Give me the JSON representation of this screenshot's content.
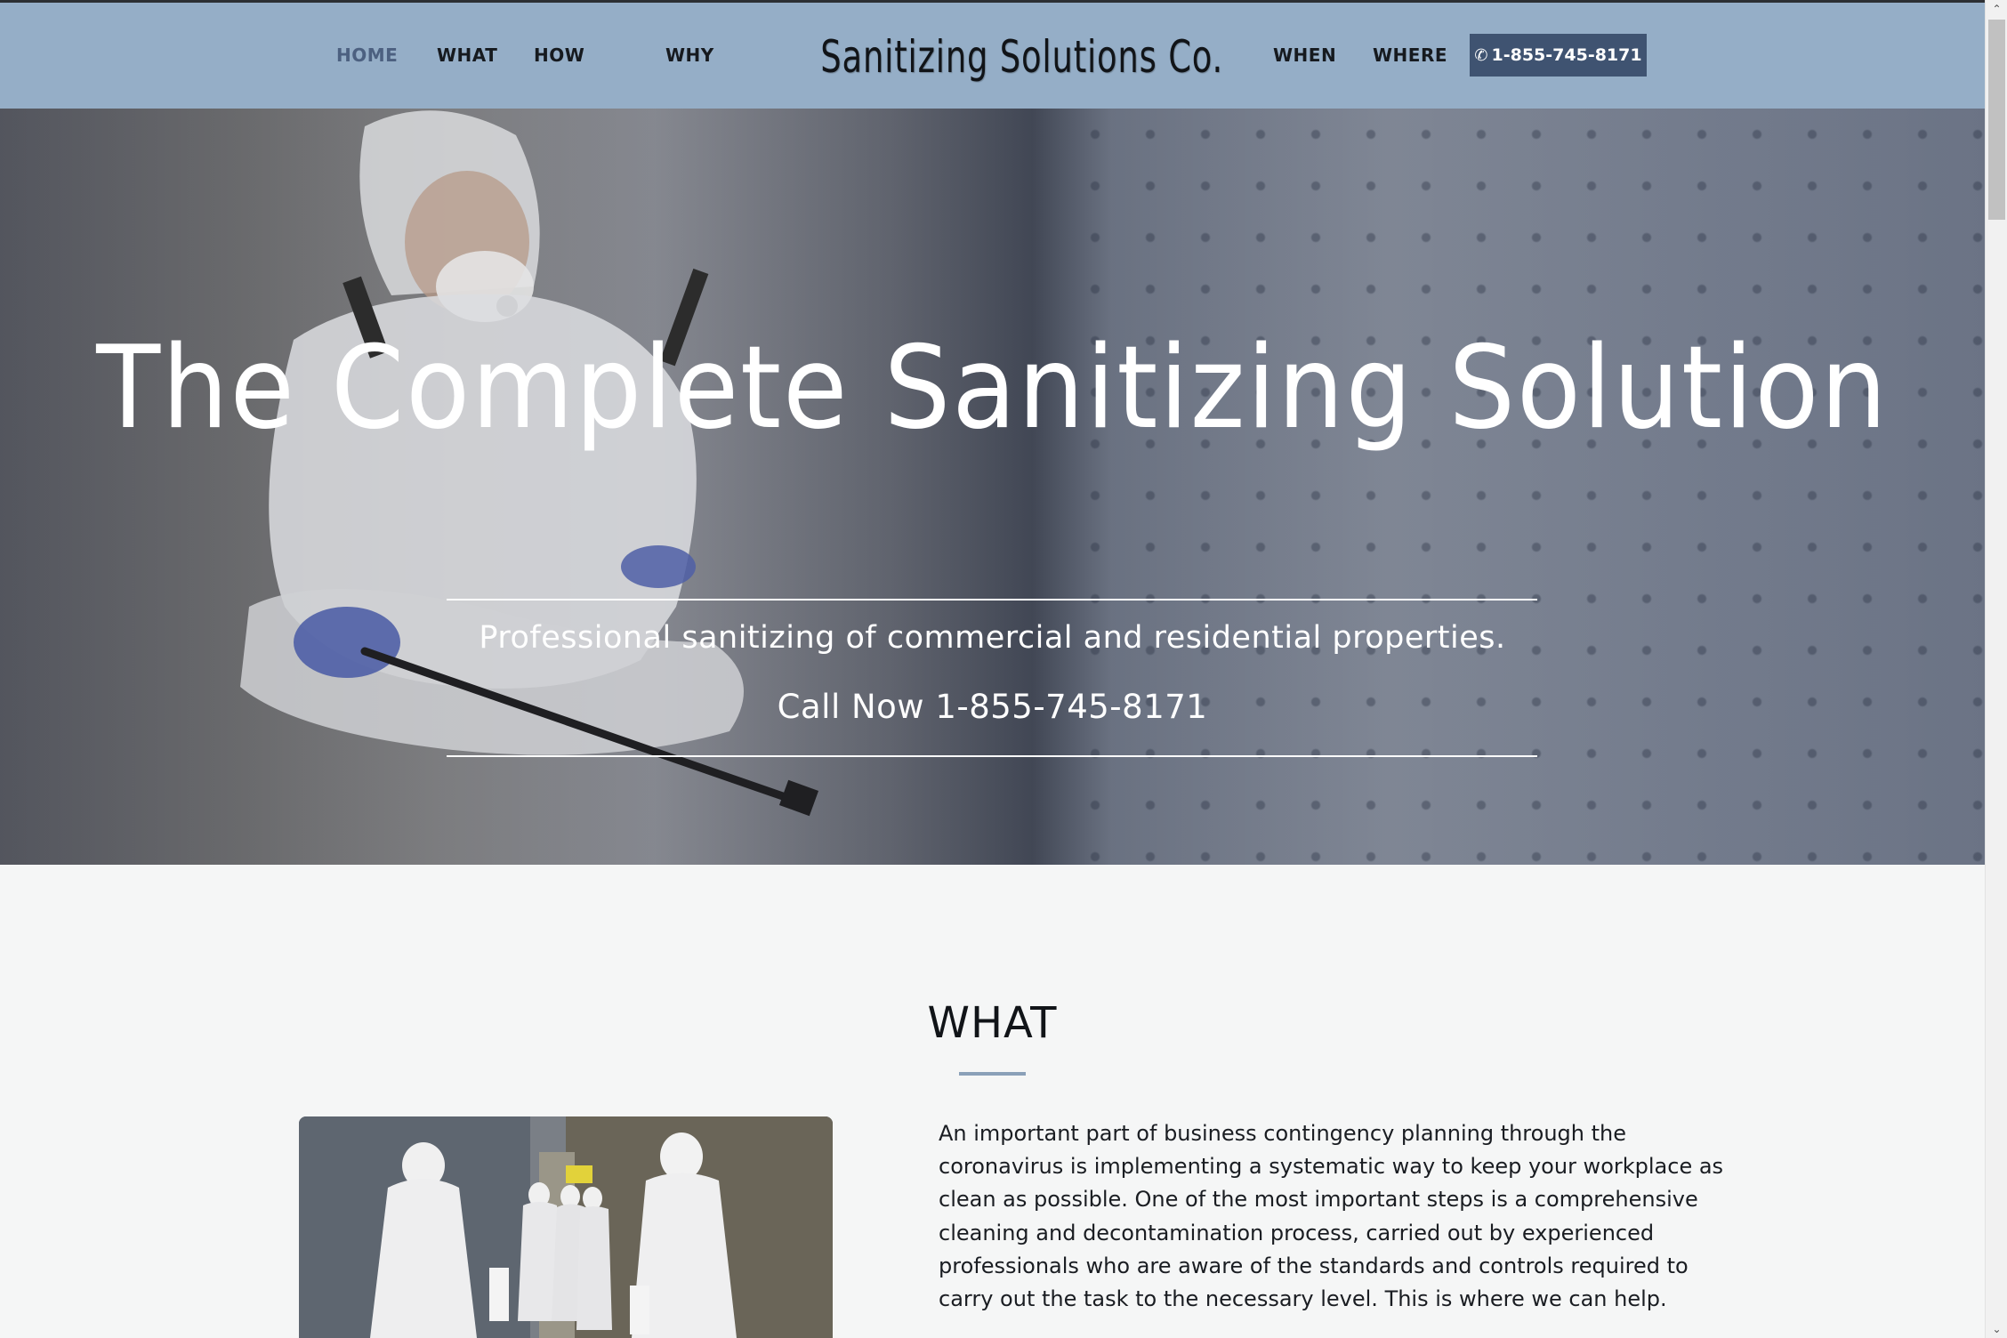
{
  "nav": {
    "left_items": [
      {
        "label": "HOME",
        "active": true
      },
      {
        "label": "WHAT"
      },
      {
        "label": "HOW"
      },
      {
        "label": "WHY"
      }
    ],
    "right_items": [
      {
        "label": "WHEN"
      },
      {
        "label": "WHERE"
      }
    ],
    "brand": "Sanitizing Solutions Co.",
    "phone_button": {
      "label": "1-855-745-8171",
      "icon": "phone-icon"
    }
  },
  "hero": {
    "title": "The Complete Sanitizing Solution",
    "subtitle": "Professional sanitizing of commercial and residential properties.",
    "call": "Call Now 1-855-745-8171"
  },
  "what_section": {
    "heading": "WHAT",
    "body": "An important part of business contingency planning through the coronavirus is implementing a systematic way to keep your workplace as clean as possible. One of the most important steps is a comprehensive cleaning and decontamination process, carried out by experienced professionals who are aware of the standards and controls required to carry out the task to the necessary level. This is where we can help."
  },
  "colors": {
    "header_bg": "#95aec7",
    "accent": "#3f5371",
    "active_nav": "#4c6080"
  },
  "scrollbar": {
    "up_icon": "chevron-up-icon",
    "down_icon": "chevron-down-icon"
  }
}
